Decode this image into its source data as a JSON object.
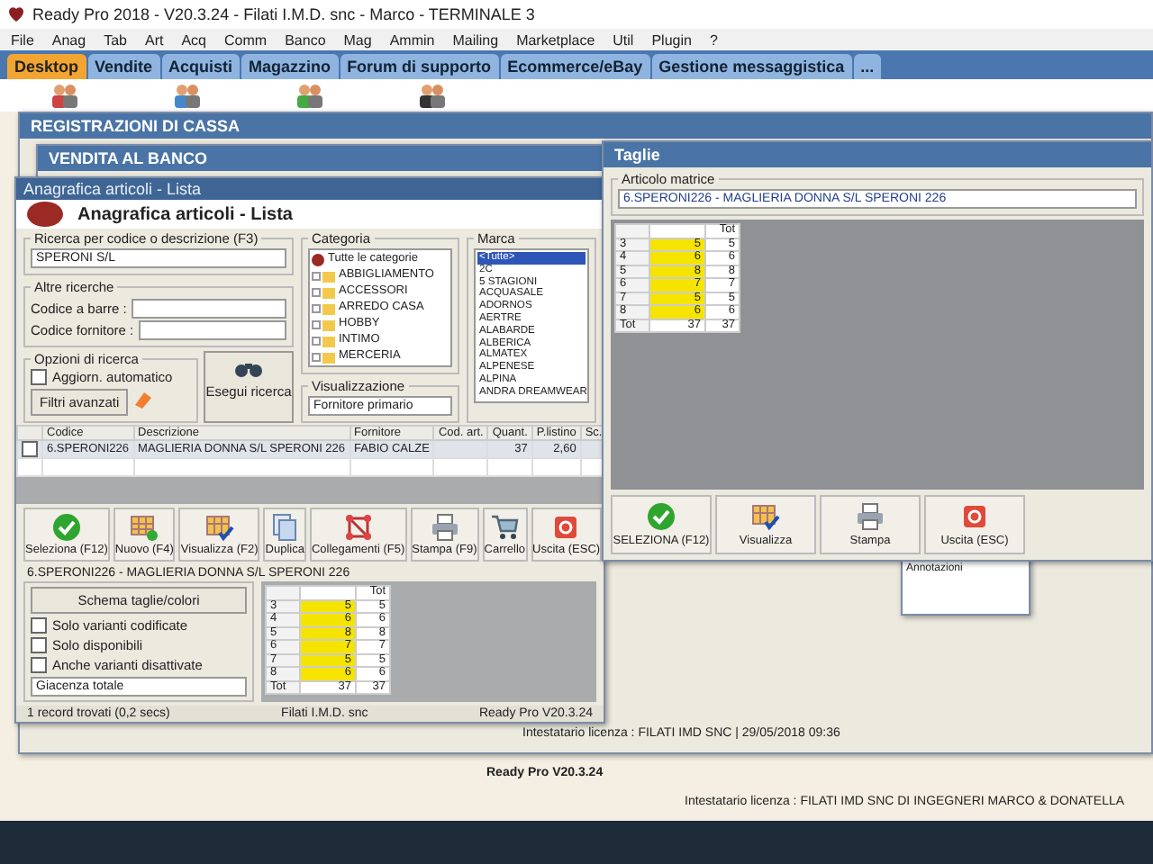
{
  "window": {
    "title": "Ready Pro 2018 - V20.3.24 - Filati I.M.D. snc - Marco - TERMINALE 3"
  },
  "menu": [
    "File",
    "Anag",
    "Tab",
    "Art",
    "Acq",
    "Comm",
    "Banco",
    "Mag",
    "Ammin",
    "Mailing",
    "Marketplace",
    "Util",
    "Plugin",
    "?"
  ],
  "tabs": [
    {
      "label": "Desktop",
      "selected": true
    },
    {
      "label": "Vendite",
      "selected": false
    },
    {
      "label": "Acquisti",
      "selected": false
    },
    {
      "label": "Magazzino",
      "selected": false
    },
    {
      "label": "Forum di supporto",
      "selected": false
    },
    {
      "label": "Ecommerce/eBay",
      "selected": false
    },
    {
      "label": "Gestione messaggistica",
      "selected": false
    },
    {
      "label": "...",
      "selected": false
    }
  ],
  "background_windows": [
    {
      "title": "REGISTRAZIONI DI CASSA"
    },
    {
      "title": "VENDITA AL BANCO"
    }
  ],
  "background_panel": {
    "label": "Annotazioni"
  },
  "articles": {
    "title": "Anagrafica articoli - Lista",
    "header": "Anagrafica articoli  - Lista",
    "search": {
      "legend": "Ricerca per codice o descrizione (F3)",
      "value": "SPERONI S/L"
    },
    "other": {
      "legend": "Altre ricerche",
      "fields": [
        "Codice a barre :",
        "Codice fornitore :"
      ]
    },
    "options": {
      "legend": "Opzioni di ricerca",
      "auto": {
        "label": "Aggiorn. automatico",
        "checked": false
      },
      "filters": "Filtri avanzati",
      "run": "Esegui ricerca"
    },
    "category": {
      "legend": "Categoria",
      "items": [
        {
          "label": "Tutte le categorie",
          "kind": "root"
        },
        {
          "label": "ABBIGLIAMENTO",
          "kind": "folder"
        },
        {
          "label": "ACCESSORI",
          "kind": "folder"
        },
        {
          "label": "ARREDO CASA",
          "kind": "folder"
        },
        {
          "label": "HOBBY",
          "kind": "folder"
        },
        {
          "label": "INTIMO",
          "kind": "folder"
        },
        {
          "label": "MERCERIA",
          "kind": "folder"
        }
      ]
    },
    "view": {
      "legend": "Visualizzazione",
      "value": "Fornitore primario"
    },
    "brand": {
      "legend": "Marca",
      "items": [
        {
          "label": "<Tutte>",
          "selected": true
        },
        {
          "label": "2C",
          "selected": false
        },
        {
          "label": "5 STAGIONI",
          "selected": false
        },
        {
          "label": "ACQUASALE",
          "selected": false
        },
        {
          "label": "ADORNOS",
          "selected": false
        },
        {
          "label": "AERTRE",
          "selected": false
        },
        {
          "label": "ALABARDE",
          "selected": false
        },
        {
          "label": "ALBERICA",
          "selected": false
        },
        {
          "label": "ALMATEX",
          "selected": false
        },
        {
          "label": "ALPENESE",
          "selected": false
        },
        {
          "label": "ALPINA",
          "selected": false
        },
        {
          "label": "ANDRA DREAMWEAR",
          "selected": false
        }
      ]
    },
    "table": {
      "columns": [
        "Codice",
        "Descrizione",
        "Fornitore",
        "Cod. art.",
        "Quant.",
        "P.listino",
        "Sc."
      ],
      "rows": [
        {
          "checked": false,
          "cells": [
            "6.SPERONI226",
            "MAGLIERIA DONNA S/L SPERONI 226",
            "FABIO CALZE",
            "",
            "37",
            "2,60",
            ""
          ]
        }
      ]
    },
    "toolbar": [
      {
        "label": "Seleziona (F12)",
        "kind": "select"
      },
      {
        "label": "Nuovo (F4)",
        "kind": "new"
      },
      {
        "label": "Visualizza (F2)",
        "kind": "view"
      },
      {
        "label": "Duplica",
        "kind": "duplicate"
      },
      {
        "label": "Collegamenti (F5)",
        "kind": "links"
      },
      {
        "label": "Stampa (F9)",
        "kind": "print"
      },
      {
        "label": "Carrello",
        "kind": "cart"
      },
      {
        "label": "Uscita (ESC)",
        "kind": "exit"
      }
    ],
    "detail": {
      "legend": "6.SPERONI226 - MAGLIERIA DONNA S/L SPERONI 226",
      "scheme": "Schema taglie/colori",
      "checks": [
        {
          "label": "Solo varianti codificate",
          "checked": false
        },
        {
          "label": "Solo disponibili",
          "checked": false
        },
        {
          "label": "Anche varianti disattivate",
          "checked": false
        }
      ],
      "stock": "Giacenza totale",
      "grid": {
        "header_total": "Tot",
        "rows": [
          {
            "size": "3",
            "qty": "5",
            "total": "5"
          },
          {
            "size": "4",
            "qty": "6",
            "total": "6"
          },
          {
            "size": "5",
            "qty": "8",
            "total": "8"
          },
          {
            "size": "6",
            "qty": "7",
            "total": "7"
          },
          {
            "size": "7",
            "qty": "5",
            "total": "5"
          },
          {
            "size": "8",
            "qty": "6",
            "total": "6"
          }
        ],
        "footer": {
          "label": "Tot",
          "qty": "37",
          "total": "37"
        }
      }
    },
    "status": [
      "1 record trovati (0,2 secs)",
      "Filati I.M.D. snc",
      "Ready Pro V20.3.24"
    ]
  },
  "sizes": {
    "title": "Taglie",
    "legend": "Articolo matrice",
    "value": "6.SPERONI226 - MAGLIERIA DONNA S/L SPERONI 226",
    "grid": {
      "header_total": "Tot",
      "rows": [
        {
          "size": "3",
          "qty": "5",
          "total": "5"
        },
        {
          "size": "4",
          "qty": "6",
          "total": "6"
        },
        {
          "size": "5",
          "qty": "8",
          "total": "8"
        },
        {
          "size": "6",
          "qty": "7",
          "total": "7"
        },
        {
          "size": "7",
          "qty": "5",
          "total": "5"
        },
        {
          "size": "8",
          "qty": "6",
          "total": "6"
        }
      ],
      "footer": {
        "label": "Tot",
        "qty": "37",
        "total": "37"
      }
    },
    "buttons": [
      {
        "label": "SELEZIONA (F12)",
        "kind": "select"
      },
      {
        "label": "Visualizza",
        "kind": "view"
      },
      {
        "label": "Stampa",
        "kind": "print"
      },
      {
        "label": "Uscita (ESC)",
        "kind": "exit"
      }
    ]
  },
  "license_bar": {
    "text": "Intestatario licenza : FILATI IMD SNC  |  29/05/2018    09:36"
  },
  "version_bar": {
    "text": "Ready Pro V20.3.24"
  },
  "main_status": {
    "text": "Intestatario licenza : FILATI IMD SNC DI INGEGNERI MARCO & DONATELLA"
  }
}
